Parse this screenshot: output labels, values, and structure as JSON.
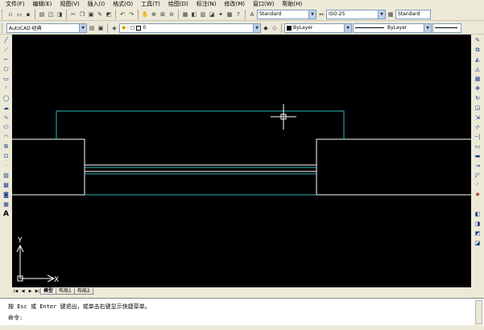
{
  "menu": {
    "file": "文件(F)",
    "edit": "编辑(E)",
    "view": "视图(V)",
    "insert": "插入(I)",
    "format": "格式(O)",
    "tools": "工具(T)",
    "draw": "绘图(D)",
    "dimension": "标注(N)",
    "modify": "修改(M)",
    "window": "窗口(W)",
    "help": "帮助(H)"
  },
  "styles": {
    "text_style": "Standard",
    "dim_style": "ISO-25",
    "table_style": "Standard"
  },
  "workspace": {
    "name": "AutoCAD 经典"
  },
  "properties": {
    "color": "ByLayer",
    "linetype": "ByLayer",
    "lineweight": "ByLayer",
    "layer": "0"
  },
  "ucs": {
    "x_label": "X",
    "y_label": "Y"
  },
  "tabs": {
    "model": "模型",
    "layout1": "布局1",
    "layout2": "布局2"
  },
  "command": {
    "history_line": "按 Esc 或 Enter 键退出，或单击右键显示快捷菜单。",
    "prompt": "命令:"
  },
  "colors": {
    "canvas_bg": "#000000",
    "line_white": "#ffffff",
    "line_cyan": "#2fb6b6",
    "chrome": "#ece9d8"
  },
  "icons": {
    "new": "new-file-icon",
    "open": "open-file-icon",
    "save": "save-icon",
    "print": "print-icon",
    "cut": "cut-icon",
    "copy": "copy-icon",
    "paste": "paste-icon",
    "undo": "undo-icon",
    "redo": "redo-icon",
    "pan": "pan-icon",
    "zoom": "zoom-icon",
    "properties": "properties-icon",
    "help": "help-icon",
    "line": "line-tool-icon",
    "circle": "circle-tool-icon",
    "text": "text-tool-icon"
  }
}
